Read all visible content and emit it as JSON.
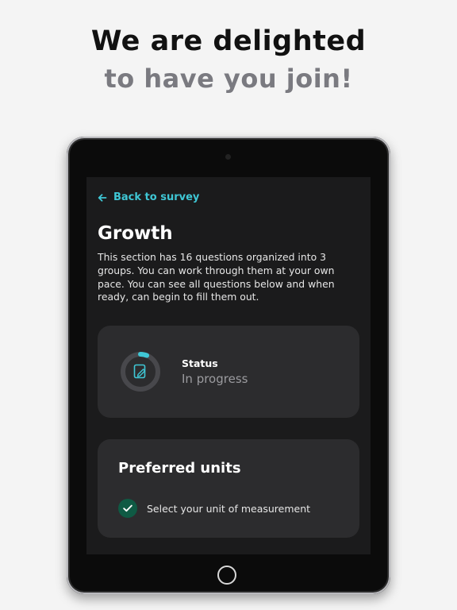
{
  "promo": {
    "line1": "We are delighted",
    "line2": "to have you join!"
  },
  "screen": {
    "back_link": "Back to survey",
    "section_title": "Growth",
    "section_description": "This section has 16 questions organized into 3 groups. You can work through them at your own pace. You can see all questions below and when ready, can begin to fill them out.",
    "status": {
      "label": "Status",
      "value": "In progress",
      "icon": "document-edit-icon",
      "progress_fraction": 0.06
    },
    "units": {
      "title": "Preferred units",
      "option_label": "Select your unit of measurement",
      "checked": true
    }
  },
  "colors": {
    "accent": "#3fc7d5",
    "check_bg": "#0f5a44",
    "card_bg": "#2c2c2e",
    "screen_bg": "#1b1b1c"
  }
}
